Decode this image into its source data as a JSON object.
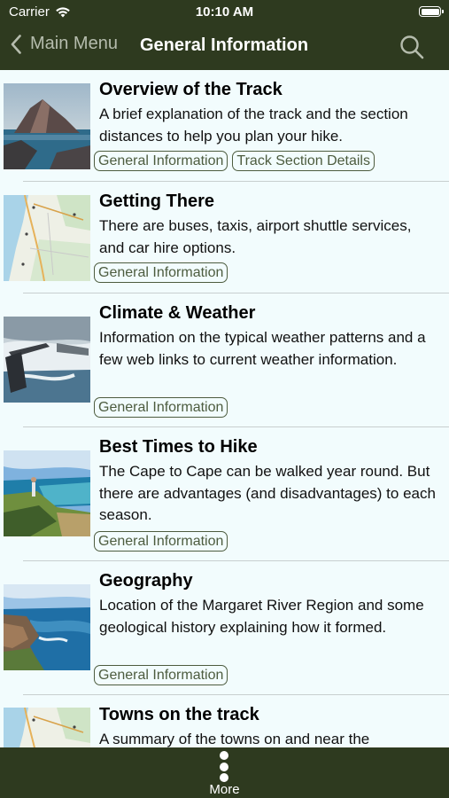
{
  "status_bar": {
    "carrier": "Carrier",
    "time": "10:10 AM"
  },
  "nav": {
    "back_label": "Main Menu",
    "title": "General Information"
  },
  "items": [
    {
      "title": "Overview of the Track",
      "description": "A brief explanation of the track and the section distances to help you plan your hike.",
      "tags": [
        "General Information",
        "Track Section Details"
      ],
      "image": "coastal-rock-photo"
    },
    {
      "title": "Getting There",
      "description": "There are buses, taxis, airport shuttle services, and car hire options.",
      "tags": [
        "General Information"
      ],
      "image": "region-map"
    },
    {
      "title": "Climate & Weather",
      "description": "Information on the typical weather patterns and a few web links to current weather information.",
      "tags": [
        "General Information"
      ],
      "image": "stormy-sea-photo"
    },
    {
      "title": "Best Times to Hike",
      "description": "The Cape to Cape can be walked year round. But there are advantages (and disadvantages) to each season.",
      "tags": [
        "General Information"
      ],
      "image": "coastal-hiker-photo"
    },
    {
      "title": "Geography",
      "description": "Location of the Margaret River Region and some geological history explaining how it formed.",
      "tags": [
        "General Information"
      ],
      "image": "coastline-photo"
    },
    {
      "title": "Towns on the track",
      "description": "A summary of the towns on and near the",
      "tags": [],
      "image": "region-map"
    }
  ],
  "bottom_bar": {
    "more_label": "More"
  },
  "colors": {
    "bar_background": "#2e3a1f",
    "list_background": "#f2fcfd",
    "tag_border": "#4d5c3f",
    "back_text": "#b5bcad"
  }
}
